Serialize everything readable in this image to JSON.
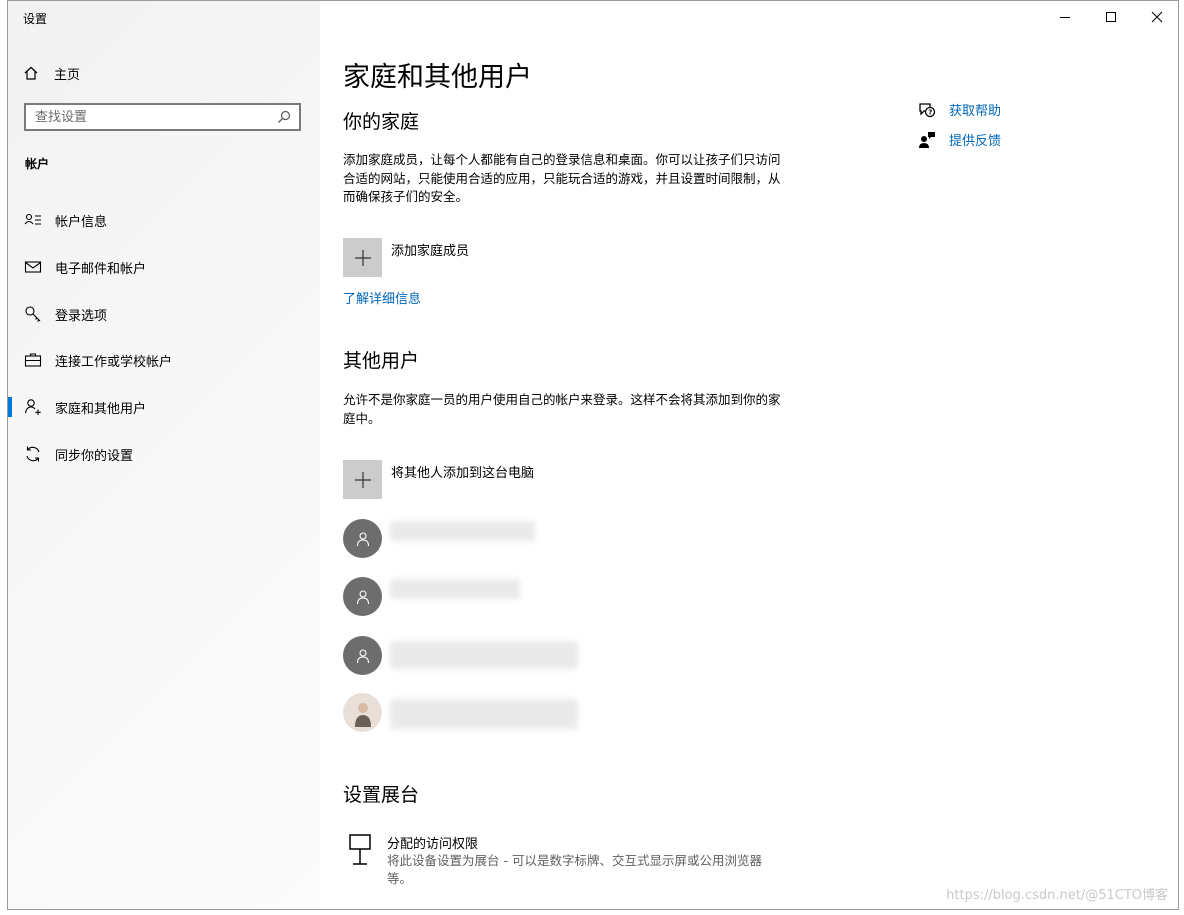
{
  "window": {
    "title": "设置"
  },
  "sidebar": {
    "home_label": "主页",
    "search_placeholder": "查找设置",
    "section_label": "帐户",
    "items": [
      {
        "label": "帐户信息",
        "icon": "account-info-icon"
      },
      {
        "label": "电子邮件和帐户",
        "icon": "mail-icon"
      },
      {
        "label": "登录选项",
        "icon": "key-icon"
      },
      {
        "label": "连接工作或学校帐户",
        "icon": "briefcase-icon"
      },
      {
        "label": "家庭和其他用户",
        "icon": "add-person-icon",
        "active": true
      },
      {
        "label": "同步你的设置",
        "icon": "sync-icon"
      }
    ]
  },
  "main": {
    "title": "家庭和其他用户",
    "family": {
      "heading": "你的家庭",
      "description": "添加家庭成员，让每个人都能有自己的登录信息和桌面。你可以让孩子们只访问合适的网站，只能使用合适的应用，只能玩合适的游戏，并且设置时间限制，从而确保孩子们的安全。",
      "add_label": "添加家庭成员",
      "learn_more": "了解详细信息"
    },
    "others": {
      "heading": "其他用户",
      "description": "允许不是你家庭一员的用户使用自己的帐户来登录。这样不会将其添加到你的家庭中。",
      "add_label": "将其他人添加到这台电脑"
    },
    "kiosk": {
      "heading": "设置展台",
      "item_title": "分配的访问权限",
      "item_desc": "将此设备设置为展台 - 可以是数字标牌、交互式显示屏或公用浏览器等。"
    },
    "help": {
      "get_help": "获取帮助",
      "feedback": "提供反馈"
    }
  },
  "watermark": "https://blog.csdn.net/@51CTO博客",
  "colors": {
    "accent": "#0078d7",
    "link": "#0067b8",
    "avatar": "#6d6d6d"
  }
}
